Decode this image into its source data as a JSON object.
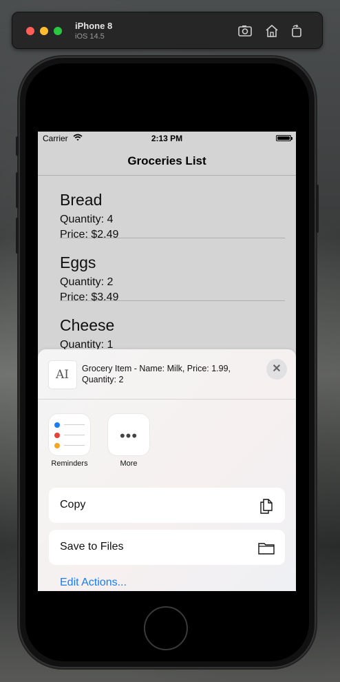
{
  "simulator": {
    "device_name": "iPhone 8",
    "os_version": "iOS 14.5",
    "toolbar_icons": [
      "screenshot-icon",
      "home-icon",
      "rotate-icon"
    ]
  },
  "status_bar": {
    "carrier": "Carrier",
    "time": "2:13 PM"
  },
  "nav": {
    "title": "Groceries List"
  },
  "items": [
    {
      "name": "Bread",
      "quantity": "Quantity: 4",
      "price": "Price: $2.49"
    },
    {
      "name": "Eggs",
      "quantity": "Quantity: 2",
      "price": "Price: $3.49"
    },
    {
      "name": "Cheese",
      "quantity": "Quantity: 1",
      "price": ""
    }
  ],
  "share_sheet": {
    "preview_icon": "AI",
    "preview_text": "Grocery Item - Name: Milk, Price: 1.99, Quantity: 2",
    "close_icon": "close-icon",
    "apps": [
      {
        "label": "Reminders",
        "icon": "reminders-icon"
      },
      {
        "label": "More",
        "icon": "more-icon"
      }
    ],
    "actions": [
      {
        "label": "Copy",
        "icon": "copy-icon"
      },
      {
        "label": "Save to Files",
        "icon": "folder-icon"
      }
    ],
    "edit_actions": "Edit Actions..."
  },
  "colors": {
    "accent": "#1a7cf4",
    "reminder_dots": [
      "#1a7cf4",
      "#e8413a",
      "#f5a623"
    ]
  }
}
